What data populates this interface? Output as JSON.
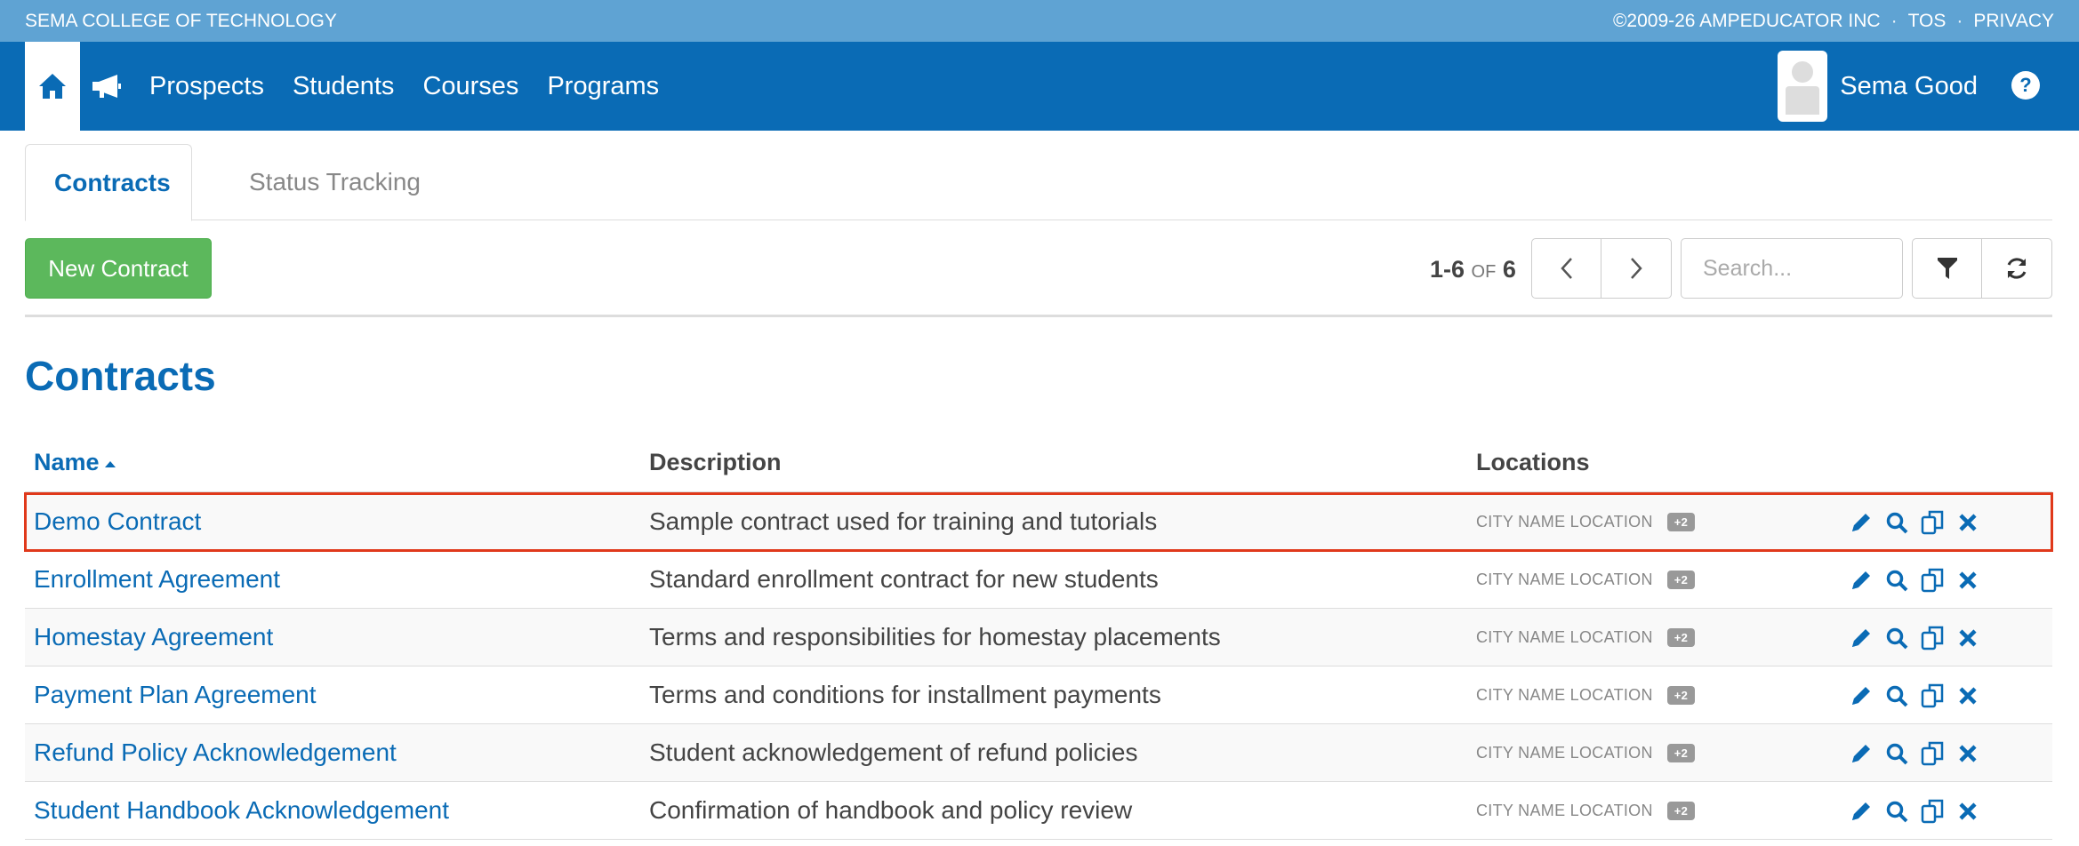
{
  "topbar": {
    "org_name": "SEMA COLLEGE OF TECHNOLOGY",
    "copyright": "©2009-26 AMPEDUCATOR INC",
    "tos": "TOS",
    "privacy": "PRIVACY",
    "separator": "·"
  },
  "navbar": {
    "items": [
      {
        "label": "Prospects"
      },
      {
        "label": "Students"
      },
      {
        "label": "Courses"
      },
      {
        "label": "Programs"
      }
    ],
    "user_name": "Sema Good",
    "help_glyph": "?"
  },
  "tabs": [
    {
      "label": "Contracts",
      "active": true
    },
    {
      "label": "Status Tracking",
      "active": false
    }
  ],
  "toolbar": {
    "new_button": "New Contract",
    "pager_range": "1-6",
    "pager_of": "OF",
    "pager_total": "6",
    "search_placeholder": "Search..."
  },
  "page": {
    "title": "Contracts"
  },
  "table": {
    "headers": {
      "name": "Name",
      "description": "Description",
      "locations": "Locations"
    },
    "sort": "name-ascending",
    "rows": [
      {
        "name": "Demo Contract",
        "description": "Sample contract used for training and tutorials",
        "location": "CITY NAME LOCATION",
        "extra": "+2"
      },
      {
        "name": "Enrollment Agreement",
        "description": "Standard enrollment contract for new students",
        "location": "CITY NAME LOCATION",
        "extra": "+2"
      },
      {
        "name": "Homestay Agreement",
        "description": "Terms and responsibilities for homestay placements",
        "location": "CITY NAME LOCATION",
        "extra": "+2"
      },
      {
        "name": "Payment Plan Agreement",
        "description": "Terms and conditions for installment payments",
        "location": "CITY NAME LOCATION",
        "extra": "+2"
      },
      {
        "name": "Refund Policy Acknowledgement",
        "description": "Student acknowledgement of refund policies",
        "location": "CITY NAME LOCATION",
        "extra": "+2"
      },
      {
        "name": "Student Handbook Acknowledgement",
        "description": "Confirmation of handbook and policy review",
        "location": "CITY NAME LOCATION",
        "extra": "+2"
      }
    ]
  },
  "icons": {
    "home": "home-icon",
    "megaphone": "megaphone-icon",
    "help": "help-icon",
    "prev": "chevron-left-icon",
    "next": "chevron-right-icon",
    "filter": "filter-icon",
    "refresh": "refresh-icon",
    "edit": "pencil-icon",
    "view": "magnifier-icon",
    "copy": "copy-icon",
    "delete": "close-icon"
  },
  "colors": {
    "topstrip": "#5fa3d3",
    "navbar": "#0a6bb5",
    "link": "#0a6bb5",
    "success_button": "#5cb85c",
    "highlight_outline": "#e0391b"
  }
}
